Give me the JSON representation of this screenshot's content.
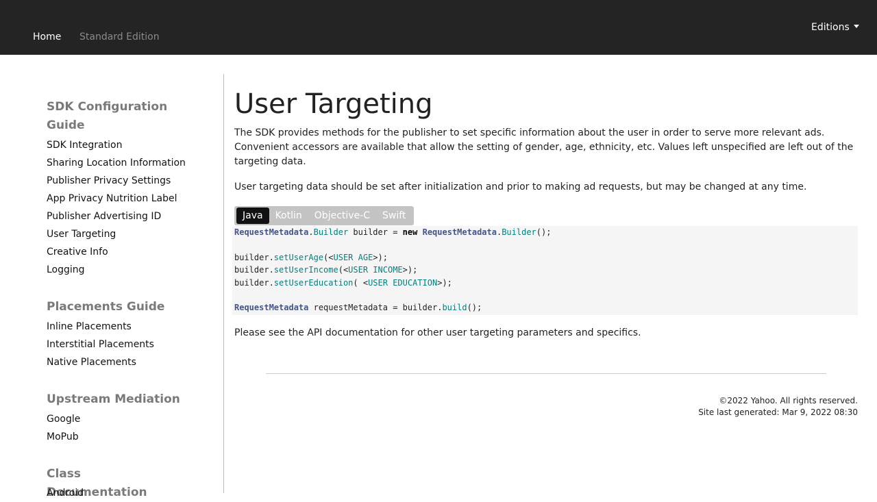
{
  "header": {
    "home": "Home",
    "edition": "Standard Edition",
    "editions_menu": "Editions"
  },
  "sidebar": {
    "sections": [
      {
        "title": "SDK Configuration Guide",
        "items": [
          "SDK Integration",
          "Sharing Location Information",
          "Publisher Privacy Settings",
          "App Privacy Nutrition Label",
          "Publisher Advertising ID",
          "User Targeting",
          "Creative Info",
          "Logging"
        ]
      },
      {
        "title": "Placements Guide",
        "items": [
          "Inline Placements",
          "Interstitial Placements",
          "Native Placements"
        ]
      },
      {
        "title": "Upstream Mediation",
        "items": [
          "Google",
          "MoPub"
        ]
      },
      {
        "title": "Class Documentation",
        "items": [
          "Android"
        ]
      }
    ]
  },
  "main": {
    "title": "User Targeting",
    "paragraph1_line1": "The SDK provides methods for the publisher to set specific information about the user in order to serve more relevant ads.",
    "paragraph1_line2": "Convenient accessors are available that allow the setting of gender, age, ethnicity, etc. Values left unspecified are left out of the",
    "paragraph1_line3": "targeting data.",
    "paragraph2": "User targeting data should be set after initialization and prior to making ad requests, but may be changed at any time.",
    "tabs": [
      "Java",
      "Kotlin",
      "Objective-C",
      "Swift"
    ],
    "active_tab": "Java",
    "code": {
      "line1": {
        "t1": "RequestMetadata",
        "p1": ".",
        "m1": "Builder",
        "p2": " builder = ",
        "kw": "new",
        "p3": " ",
        "t2": "RequestMetadata",
        "p4": ".",
        "m2": "Builder",
        "p5": "();"
      },
      "line2": {
        "p1": "builder.",
        "m": "setUserAge",
        "p2": "(<",
        "c": "USER AGE",
        "p3": ">);"
      },
      "line3": {
        "p1": "builder.",
        "m": "setUserIncome",
        "p2": "(<",
        "c": "USER INCOME",
        "p3": ">);"
      },
      "line4": {
        "p1": "builder.",
        "m": "setUserEducation",
        "p2": "( <",
        "c": "USER EDUCATION",
        "p3": ">);"
      },
      "line5": {
        "t": "RequestMetadata",
        "p1": " requestMetadata = builder.",
        "m": "build",
        "p2": "();"
      }
    },
    "after_code": "Please see the API documentation for other user targeting parameters and specifics."
  },
  "footer": {
    "copyright": "©2022 Yahoo. All rights reserved.",
    "generated": "Site last generated: Mar 9, 2022 08:30"
  }
}
